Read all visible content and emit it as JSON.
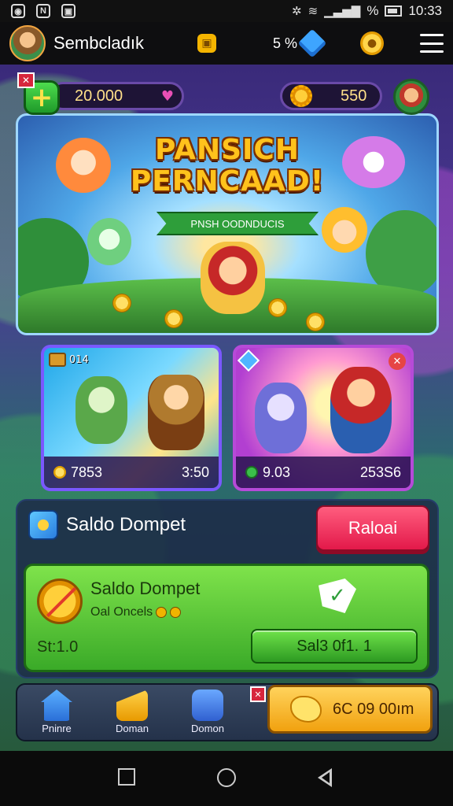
{
  "status_bar": {
    "time": "10:33",
    "percent": "%"
  },
  "header": {
    "username": "Sembcladık",
    "percent_value": "5 %"
  },
  "currency": {
    "left_amount": "20.000",
    "right_amount": "550"
  },
  "hero": {
    "title_line1": "PANSICH",
    "title_line2": "PERNCAAD!",
    "ribbon": "PNSH OODNDUCIS"
  },
  "cards": [
    {
      "chest_label": "014",
      "left_value": "7853",
      "right_value": "3:50"
    },
    {
      "left_value": "9.03",
      "right_value": "253S6"
    }
  ],
  "wallet": {
    "label": "Saldo Dompet",
    "reload_label": "Raloai"
  },
  "balance": {
    "title": "Saldo Dompet",
    "subtitle": "Oal Oncels",
    "amount": "St:1.0",
    "claim_label": "Sal3 0f1. 1"
  },
  "bottom_nav": {
    "items": [
      {
        "label": "Pninre",
        "icon": "home-icon"
      },
      {
        "label": "Doman",
        "icon": "cheese-icon"
      },
      {
        "label": "Domon",
        "icon": "puzzle-icon"
      }
    ],
    "gold_label": "6C 09 00ım"
  },
  "colors": {
    "reload": "#e3194a",
    "balance_green": "#3aaa28",
    "gold": "#f1a10f",
    "card_a_border": "#7a58ff",
    "card_b_border": "#b64ad8"
  }
}
